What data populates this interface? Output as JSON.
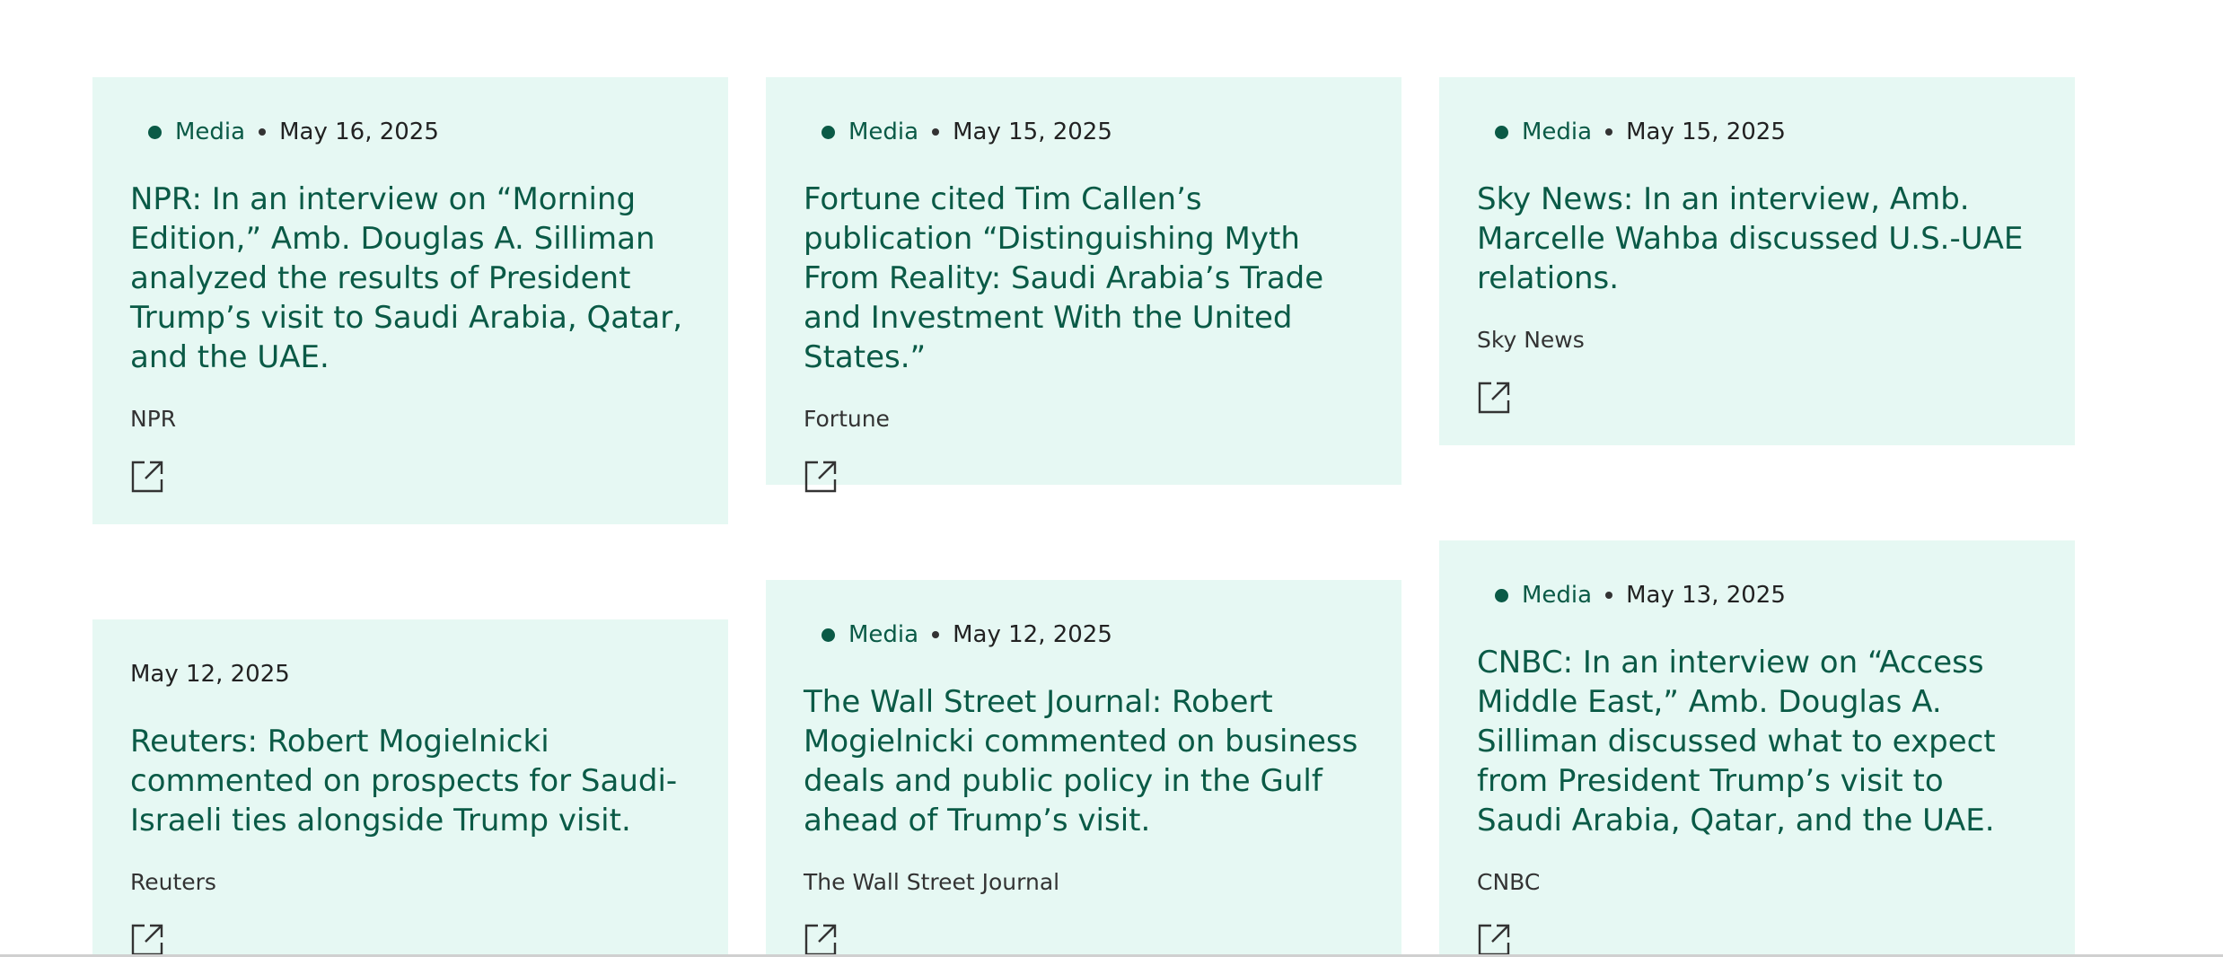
{
  "cards": [
    {
      "tag": "Media",
      "date": "May 16, 2025",
      "title": "NPR: In an interview on “Morning Edition,” Amb. Douglas A. Silliman analyzed the results of President Trump’s visit to Saudi Arabia, Qatar, and the UAE.",
      "source": "NPR"
    },
    {
      "tag": "Media",
      "date": "May 15, 2025",
      "title": "Fortune cited Tim Callen’s publication “Distinguishing Myth From Reality: Saudi Arabia’s Trade and Investment With the United States.”",
      "source": "Fortune"
    },
    {
      "tag": "Media",
      "date": "May 15, 2025",
      "title": "Sky News: In an interview, Amb. Marcelle Wahba discussed U.S.-UAE relations.",
      "source": "Sky News"
    },
    {
      "date": "May 12, 2025",
      "title": "Reuters: Robert Mogielnicki commented on prospects for Saudi-Israeli ties alongside Trump visit.",
      "source": "Reuters"
    },
    {
      "tag": "Media",
      "date": "May 12, 2025",
      "title": "The Wall Street Journal: Robert Mogielnicki commented on business deals and public policy in the Gulf ahead of Trump’s visit.",
      "source": "The Wall Street Journal"
    },
    {
      "tag": "Media",
      "date": "May 13, 2025",
      "title": "CNBC: In an interview on “Access Middle East,” Amb. Douglas A. Silliman discussed what to expect from President Trump’s visit to Saudi Arabia, Qatar, and the UAE.",
      "source": "CNBC"
    }
  ],
  "colors": {
    "card_bg": "#e6f8f3",
    "accent": "#0a5a46"
  },
  "icons": {
    "external": "external-link-icon"
  }
}
